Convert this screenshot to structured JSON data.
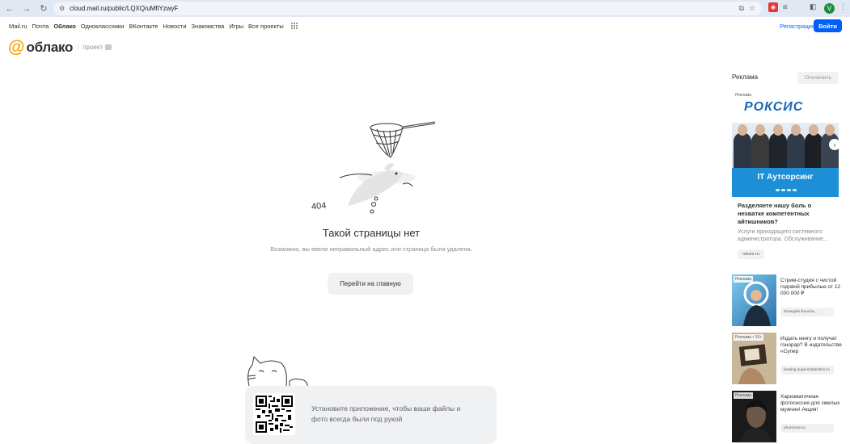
{
  "browser": {
    "url": "cloud.mail.ru/public/LQXQ/uMfiYzwyF",
    "profile_letter": "V"
  },
  "portal": {
    "links": [
      "Mail.ru",
      "Почта",
      "Облако",
      "Одноклассники",
      "ВКонтакте",
      "Новости",
      "Знакомства",
      "Игры",
      "Все проекты"
    ],
    "active": "Облако",
    "register": "Регистрация",
    "login": "Войти"
  },
  "logo": {
    "name": "облако",
    "project": "проект"
  },
  "error": {
    "code": "404",
    "title": "Такой страницы нет",
    "description": "Возможно, вы ввели неправильный адрес или страница была удалена.",
    "home_button": "Перейти на главную"
  },
  "app_banner": {
    "text": "Установите приложение, чтобы ваши файлы и фото всегда были под рукой"
  },
  "ads": {
    "label": "Реклама",
    "disable": "Отключить",
    "big": {
      "tag": "Реклама",
      "brand": "РОКСИС",
      "banner_text": "IT Аутсорсинг",
      "title": "Разделяете нашу боль о нехватке компетентных айтишников?",
      "description": "Услуги приходящего системного администратора. Обслуживание...",
      "domain": "roksis.ru"
    },
    "small": [
      {
        "tag": "Реклама",
        "title": "Стрим-студия с чистой годовой прибылью от 12 000 000 ₽",
        "domain": "showgirls-francha..."
      },
      {
        "tag": "Реклама • 16+",
        "title": "Издать книгу и получат гонорар? В издательстве «Супер",
        "domain": "landing.superizdatelstvo.ru"
      },
      {
        "tag": "Реклама",
        "title": "Харизматичная фотосессия для смелых мужчин! Акция!",
        "domain": "photoman.ru"
      }
    ]
  }
}
